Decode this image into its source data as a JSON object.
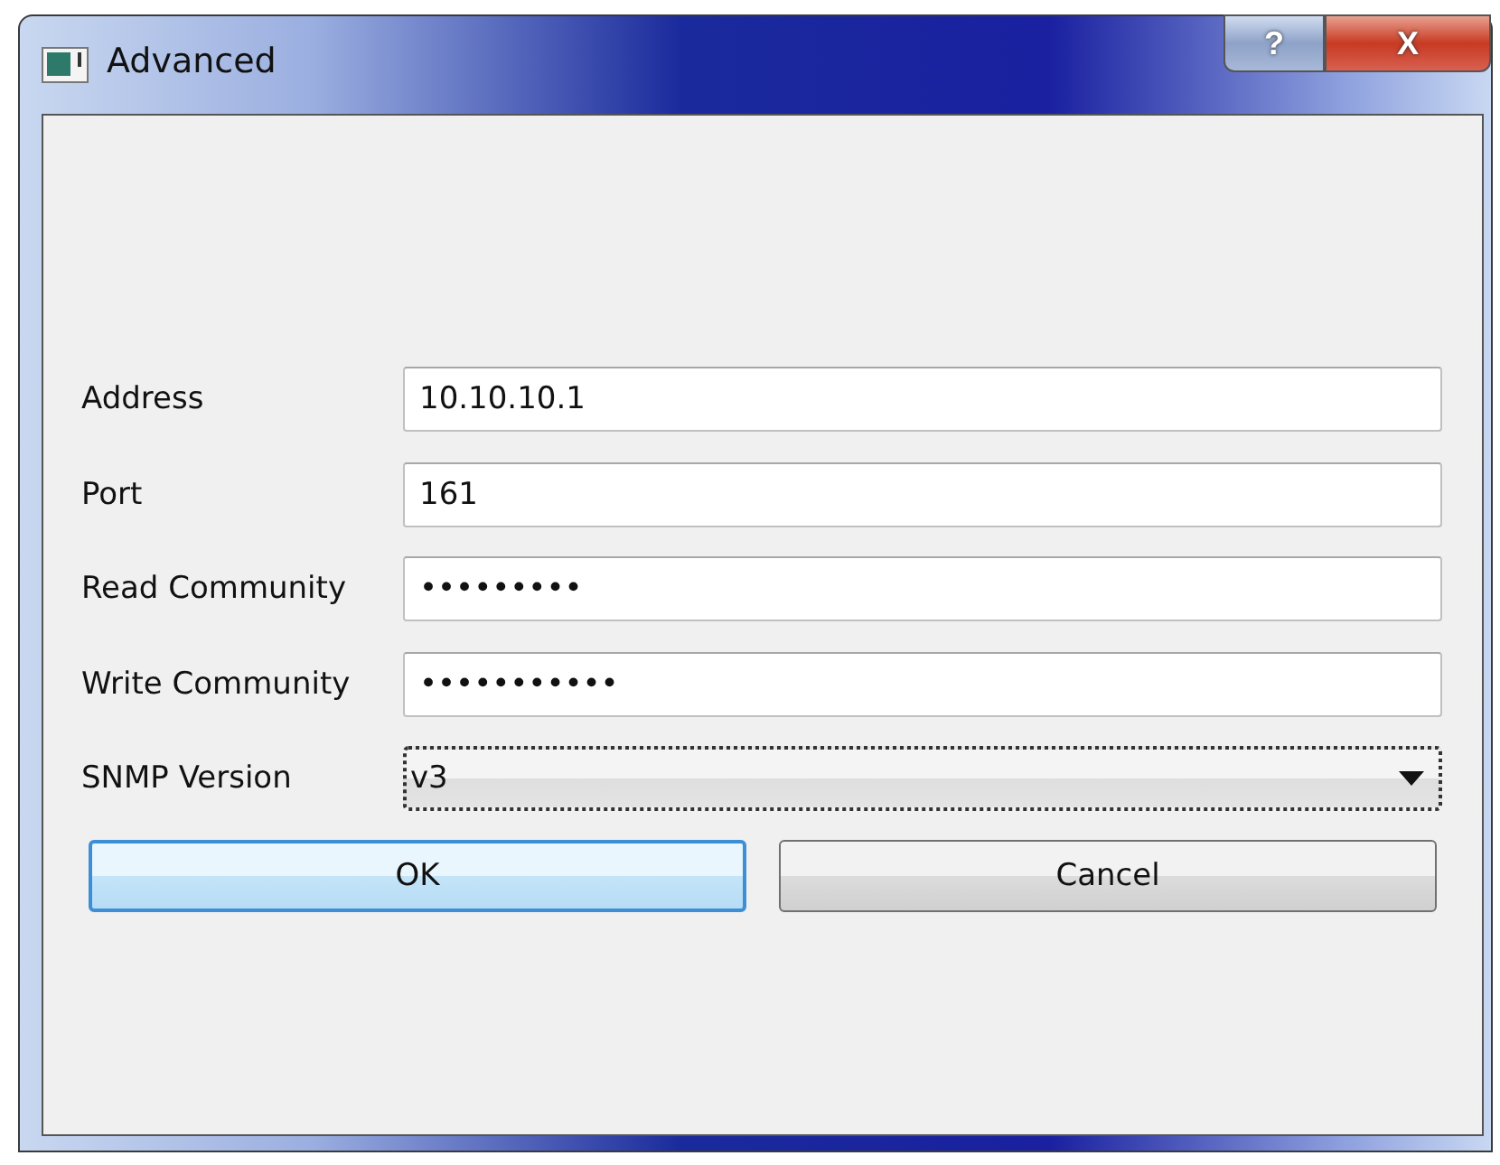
{
  "window": {
    "title": "Advanced",
    "buttons": [
      {
        "kind": "help",
        "label": "?"
      },
      {
        "kind": "close",
        "label": "X"
      }
    ]
  },
  "fields": [
    {
      "kind": "text",
      "label": "Address",
      "value": "10.10.10.1"
    },
    {
      "kind": "text",
      "label": "Port",
      "value": "161"
    },
    {
      "kind": "text",
      "label": "Read Community",
      "value": "•••••••••"
    },
    {
      "kind": "text",
      "label": "Write Community",
      "value": "•••••••••••"
    },
    {
      "kind": "combo",
      "label": "SNMP Version",
      "value": "v3",
      "focused": true
    }
  ],
  "buttons": [
    {
      "label": "OK",
      "default": true
    },
    {
      "label": "Cancel",
      "default": false
    }
  ]
}
